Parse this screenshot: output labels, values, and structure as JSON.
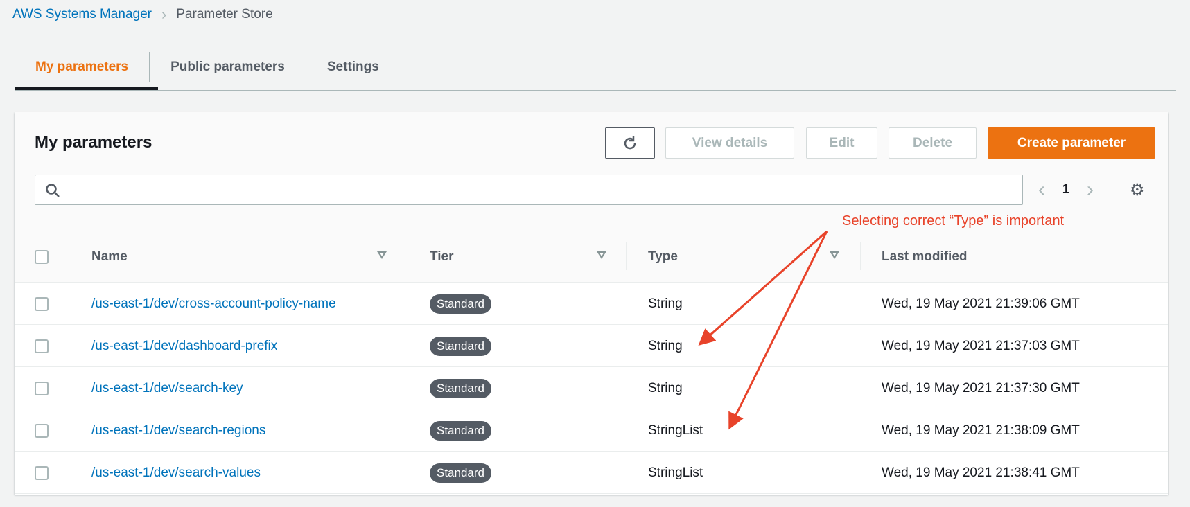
{
  "breadcrumb": {
    "parent": "AWS Systems Manager",
    "current": "Parameter Store"
  },
  "tabs": [
    {
      "label": "My parameters"
    },
    {
      "label": "Public parameters"
    },
    {
      "label": "Settings"
    }
  ],
  "panel": {
    "title": "My parameters",
    "buttons": {
      "view_details": "View details",
      "edit": "Edit",
      "delete": "Delete",
      "create": "Create parameter"
    },
    "search": {
      "placeholder": "",
      "value": ""
    },
    "pagination": {
      "page": "1"
    },
    "columns": [
      "Name",
      "Tier",
      "Type",
      "Last modified"
    ],
    "rows": [
      {
        "name": "/us-east-1/dev/cross-account-policy-name",
        "tier": "Standard",
        "type": "String",
        "modified": "Wed, 19 May 2021 21:39:06 GMT"
      },
      {
        "name": "/us-east-1/dev/dashboard-prefix",
        "tier": "Standard",
        "type": "String",
        "modified": "Wed, 19 May 2021 21:37:03 GMT"
      },
      {
        "name": "/us-east-1/dev/search-key",
        "tier": "Standard",
        "type": "String",
        "modified": "Wed, 19 May 2021 21:37:30 GMT"
      },
      {
        "name": "/us-east-1/dev/search-regions",
        "tier": "Standard",
        "type": "StringList",
        "modified": "Wed, 19 May 2021 21:38:09 GMT"
      },
      {
        "name": "/us-east-1/dev/search-values",
        "tier": "Standard",
        "type": "StringList",
        "modified": "Wed, 19 May 2021 21:38:41 GMT"
      }
    ]
  },
  "annotation": {
    "text": "Selecting correct “Type” is important",
    "color": "#e8432a"
  },
  "colors": {
    "accent": "#ec7211",
    "link": "#0073bb"
  }
}
